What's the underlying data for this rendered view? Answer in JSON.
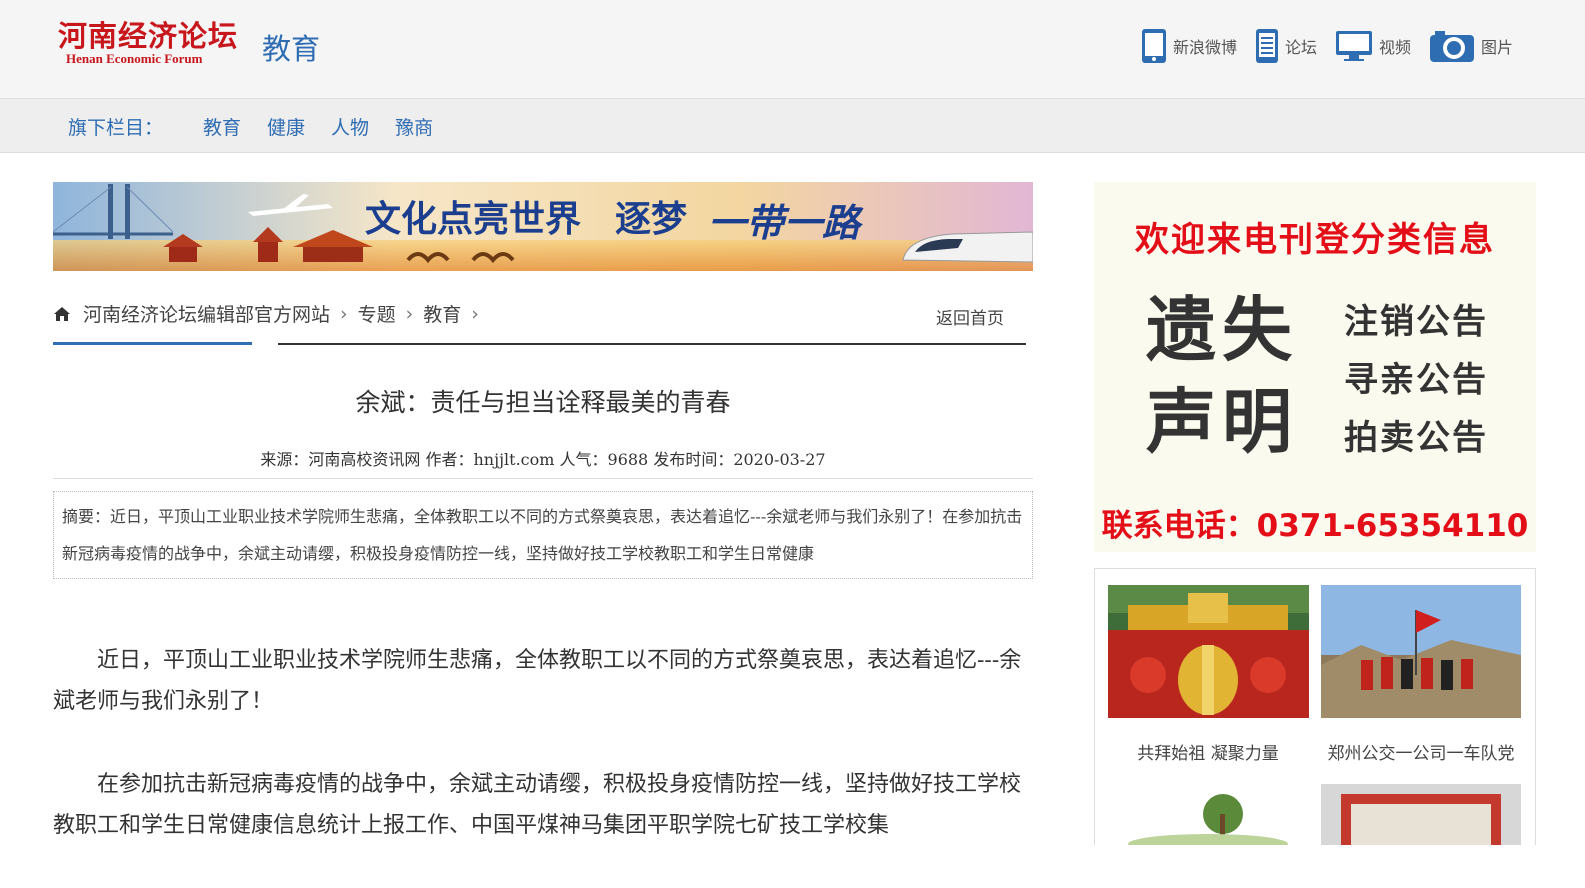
{
  "header": {
    "logo_cn": "河南经济论坛",
    "logo_en": "Henan Economic Forum",
    "section": "教育",
    "links": [
      {
        "label": "新浪微博",
        "icon": "phone-icon"
      },
      {
        "label": "论坛",
        "icon": "tablet-icon"
      },
      {
        "label": "视频",
        "icon": "monitor-icon"
      },
      {
        "label": "图片",
        "icon": "camera-icon"
      }
    ],
    "accent_color": "#2f6db3",
    "brand_color": "#c8161d"
  },
  "subnav": {
    "label": "旗下栏目：",
    "items": [
      "教育",
      "健康",
      "人物",
      "豫商"
    ]
  },
  "banner": {
    "text1": "文化点亮世界",
    "text2": "逐梦",
    "text3": "一带一路"
  },
  "breadcrumb": {
    "items": [
      "河南经济论坛编辑部官方网站",
      "专题",
      "教育"
    ],
    "home": "返回首页"
  },
  "article": {
    "title": "余斌：责任与担当诠释最美的青春",
    "meta": "来源：河南高校资讯网 作者：hnjjlt.com 人气：9688 发布时间：2020-03-27",
    "summary": "摘要：近日，平顶山工业职业技术学院师生悲痛，全体教职工以不同的方式祭奠哀思，表达着追忆---余斌老师与我们永别了！在参加抗击新冠病毒疫情的战争中，余斌主动请缨，积极投身疫情防控一线，坚持做好技工学校教职工和学生日常健康",
    "paragraphs": [
      "近日，平顶山工业职业技术学院师生悲痛，全体教职工以不同的方式祭奠哀思，表达着追忆---余斌老师与我们永别了！",
      "在参加抗击新冠病毒疫情的战争中，余斌主动请缨，积极投身疫情防控一线，坚持做好技工学校教职工和学生日常健康信息统计上报工作、中国平煤神马集团平职学院七矿技工学校集"
    ]
  },
  "ad": {
    "title": "欢迎来电刊登分类信息",
    "big1": "遗失",
    "big2": "声明",
    "small": [
      "注销公告",
      "寻亲公告",
      "拍卖公告"
    ],
    "phone": "联系电话：0371-65354110"
  },
  "photos": [
    {
      "caption": "共拜始祖 凝聚力量"
    },
    {
      "caption": "郑州公交一公司一车队党"
    },
    {
      "caption": ""
    },
    {
      "caption": ""
    }
  ]
}
